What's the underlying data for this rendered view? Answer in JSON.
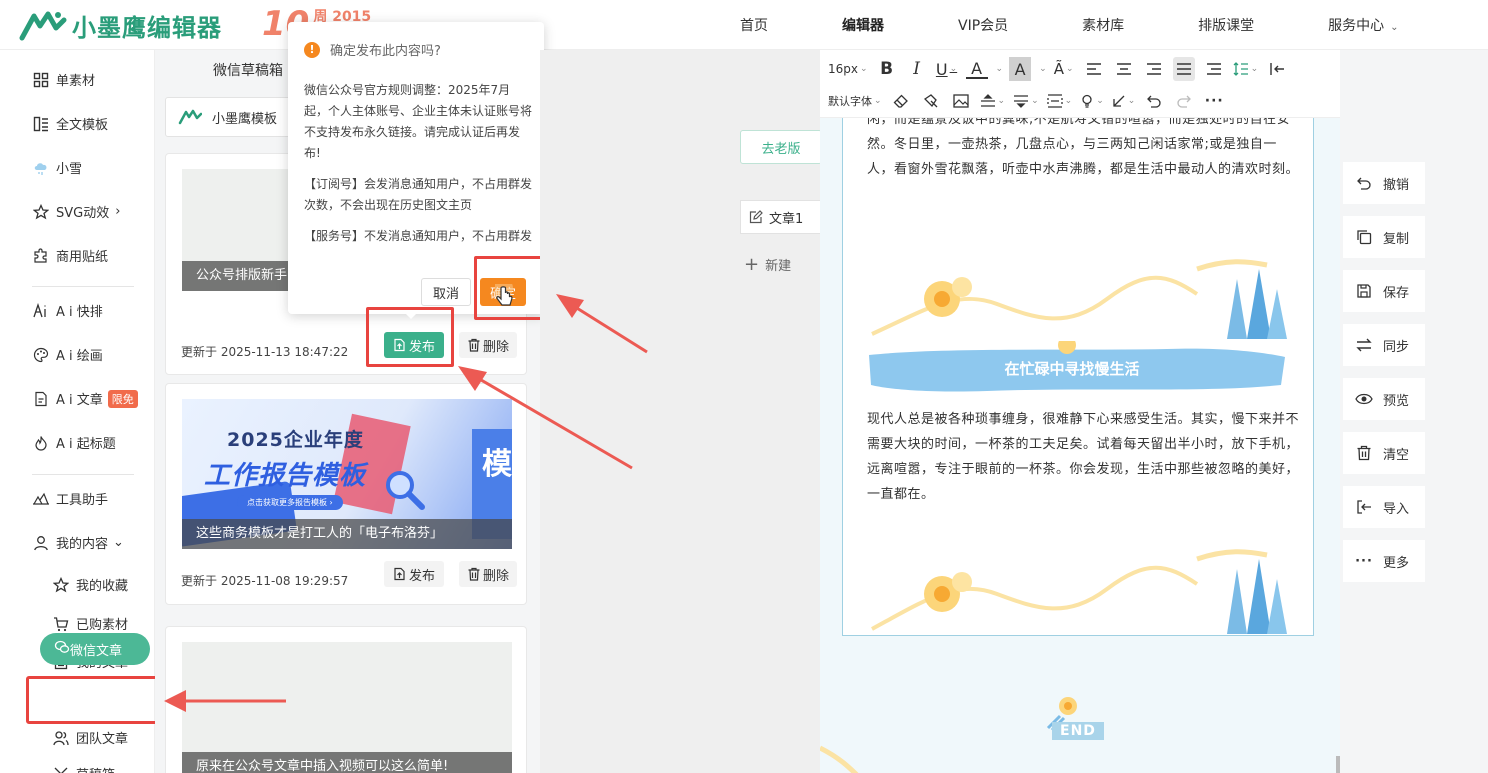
{
  "brand": {
    "name": "小墨鹰编辑器",
    "anniversary_num": "10",
    "anniversary_label": "周 2015",
    "brand_color": "#2a9d7a",
    "accent_color": "#3bb08b"
  },
  "nav": {
    "items": [
      {
        "label": "首页"
      },
      {
        "label": "编辑器"
      },
      {
        "label": "VIP会员"
      },
      {
        "label": "素材库"
      },
      {
        "label": "排版课堂"
      },
      {
        "label": "服务中心"
      }
    ]
  },
  "sidebar": {
    "items": [
      {
        "label": "单素材",
        "icon": "grid-icon"
      },
      {
        "label": "全文模板",
        "icon": "template-icon"
      },
      {
        "label": "小雪",
        "icon": "cloud-icon"
      },
      {
        "label": "SVG动效",
        "icon": "star-icon",
        "suffix": "›"
      },
      {
        "label": "商用贴纸",
        "icon": "puzzle-icon"
      },
      {
        "label": "A i 快排",
        "icon": "ai-icon"
      },
      {
        "label": "A i 绘画",
        "icon": "palette-icon"
      },
      {
        "label": "A i 文章",
        "icon": "doc-icon",
        "badge": "限免"
      },
      {
        "label": "A i 起标题",
        "icon": "fire-icon"
      },
      {
        "label": "工具助手",
        "icon": "tools-icon"
      },
      {
        "label": "我的内容",
        "icon": "user-icon",
        "suffix": "⌄"
      },
      {
        "label": "我的收藏",
        "icon": "star-outline-icon"
      },
      {
        "label": "已购素材",
        "icon": "cart-icon"
      },
      {
        "label": "我的文章",
        "icon": "article-icon"
      },
      {
        "label": "微信文章",
        "icon": "wechat-icon"
      },
      {
        "label": "团队文章",
        "icon": "team-icon"
      },
      {
        "label": "草稿箱",
        "icon": "draft-icon"
      }
    ]
  },
  "drafts": {
    "title": "微信草稿箱",
    "account": "小墨鹰模板",
    "cards": [
      {
        "caption": "公众号排版新手",
        "date": "更新于 2025-11-13 18:47:22",
        "publish": "发布",
        "delete": "删除"
      },
      {
        "caption": "这些商务模板才是打工人的「电子布洛芬」",
        "date": "更新于 2025-11-08 19:29:57",
        "publish": "发布",
        "delete": "删除",
        "thumb_title1": "2025企业年度",
        "thumb_title2": "工作报告模板",
        "thumb_sub": "点击获取更多报告模板 ›",
        "thumb_side": "模"
      },
      {
        "caption": "原来在公众号文章中插入视频可以这么简单!"
      }
    ]
  },
  "popover": {
    "title": "确定发布此内容吗?",
    "para1": "微信公众号官方规则调整：2025年7月起，个人主体账号、企业主体未认证账号将不支持发布永久链接。请完成认证后再发布!",
    "para2": "【订阅号】会发消息通知用户，不占用群发次数，不会出现在历史图文主页",
    "para3": "【服务号】不发消息通知用户，不占用群发次数，不会出现在历史图文主页",
    "cancel": "取消",
    "confirm": "确定",
    "confirm_color": "#f5881f"
  },
  "middle": {
    "old_version": "去老版",
    "article_tab": "文章1",
    "new_tab": "新建"
  },
  "toolbar": {
    "font_size": "16px",
    "default_font": "默认字体"
  },
  "article": {
    "para_top": "闲，而是蕴景及饭中的冀味,不是航寿文错的喧嚣，而是独处时的自在安然。冬日里，一壶热茶，几盘点心，与三两知己闲话家常;或是独自一人，看窗外雪花飘落，听壶中水声沸腾，都是生活中最动人的清欢时刻。",
    "banner": "在忙碌中寻找慢生活",
    "para_mid": "现代人总是被各种琐事缠身，很难静下心来感受生活。其实，慢下来并不需要大块的时间，一杯茶的工夫足矣。试着每天留出半小时，放下手机，远离喧嚣，专注于眼前的一杯茶。你会发现，生活中那些被忽略的美好，一直都在。",
    "end": "END"
  },
  "actions": [
    {
      "label": "撤销",
      "icon": "undo-icon"
    },
    {
      "label": "复制",
      "icon": "copy-icon"
    },
    {
      "label": "保存",
      "icon": "save-icon"
    },
    {
      "label": "同步",
      "icon": "sync-icon"
    },
    {
      "label": "预览",
      "icon": "eye-icon"
    },
    {
      "label": "清空",
      "icon": "trash-icon"
    },
    {
      "label": "导入",
      "icon": "import-icon"
    },
    {
      "label": "更多",
      "icon": "more-icon"
    }
  ],
  "annotation_color": "#e8443f"
}
